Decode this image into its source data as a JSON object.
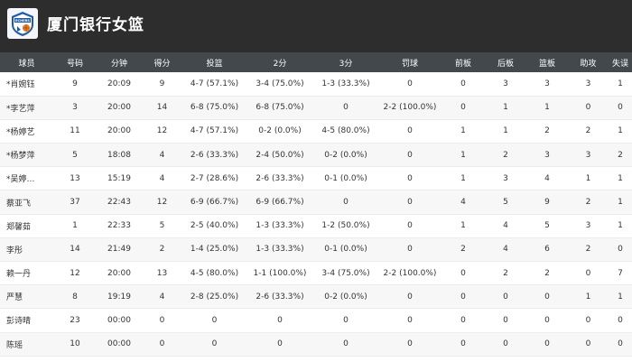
{
  "team": {
    "name": "厦门银行女篮",
    "logo_icon": "team-badge-icon",
    "logo_text": "ECHERS"
  },
  "columns": [
    "球员",
    "号码",
    "分钟",
    "得分",
    "投篮",
    "2分",
    "3分",
    "罚球",
    "前板",
    "后板",
    "篮板",
    "助攻",
    "失误"
  ],
  "players": [
    [
      "*肖婉钰",
      "9",
      "20:09",
      "9",
      "4-7 (57.1%)",
      "3-4 (75.0%)",
      "1-3 (33.3%)",
      "0",
      "0",
      "3",
      "3",
      "3",
      "1"
    ],
    [
      "*李艺萍",
      "3",
      "20:00",
      "14",
      "6-8 (75.0%)",
      "6-8 (75.0%)",
      "0",
      "2-2 (100.0%)",
      "0",
      "1",
      "1",
      "0",
      "0"
    ],
    [
      "*杨婷艺",
      "11",
      "20:00",
      "12",
      "4-7 (57.1%)",
      "0-2 (0.0%)",
      "4-5 (80.0%)",
      "0",
      "1",
      "1",
      "2",
      "2",
      "1"
    ],
    [
      "*杨梦萍",
      "5",
      "18:08",
      "4",
      "2-6 (33.3%)",
      "2-4 (50.0%)",
      "0-2 (0.0%)",
      "0",
      "1",
      "2",
      "3",
      "3",
      "2"
    ],
    [
      "*吴婷…",
      "13",
      "15:19",
      "4",
      "2-7 (28.6%)",
      "2-6 (33.3%)",
      "0-1 (0.0%)",
      "0",
      "1",
      "3",
      "4",
      "1",
      "1"
    ],
    [
      "蔡亚飞",
      "37",
      "22:43",
      "12",
      "6-9 (66.7%)",
      "6-9 (66.7%)",
      "0",
      "0",
      "4",
      "5",
      "9",
      "2",
      "1"
    ],
    [
      "郑馨茹",
      "1",
      "22:33",
      "5",
      "2-5 (40.0%)",
      "1-3 (33.3%)",
      "1-2 (50.0%)",
      "0",
      "1",
      "4",
      "5",
      "3",
      "1"
    ],
    [
      "李彤",
      "14",
      "21:49",
      "2",
      "1-4 (25.0%)",
      "1-3 (33.3%)",
      "0-1 (0.0%)",
      "0",
      "2",
      "4",
      "6",
      "2",
      "0"
    ],
    [
      "赖一丹",
      "12",
      "20:00",
      "13",
      "4-5 (80.0%)",
      "1-1 (100.0%)",
      "3-4 (75.0%)",
      "2-2 (100.0%)",
      "0",
      "2",
      "2",
      "0",
      "7"
    ],
    [
      "严慧",
      "8",
      "19:19",
      "4",
      "2-8 (25.0%)",
      "2-6 (33.3%)",
      "0-2 (0.0%)",
      "0",
      "0",
      "0",
      "0",
      "1",
      "1"
    ],
    [
      "彭诗晴",
      "23",
      "00:00",
      "0",
      "0",
      "0",
      "0",
      "0",
      "0",
      "0",
      "0",
      "0",
      "0"
    ],
    [
      "陈瑶",
      "10",
      "00:00",
      "0",
      "0",
      "0",
      "0",
      "0",
      "0",
      "0",
      "0",
      "0",
      "0"
    ]
  ],
  "colors": {
    "header_bg": "#2d2d2d",
    "table_header_bg": "#43484c",
    "row_alt_bg": "#f7f7f7",
    "logo_blue": "#1f5aa8",
    "logo_orange": "#e87a1e"
  }
}
